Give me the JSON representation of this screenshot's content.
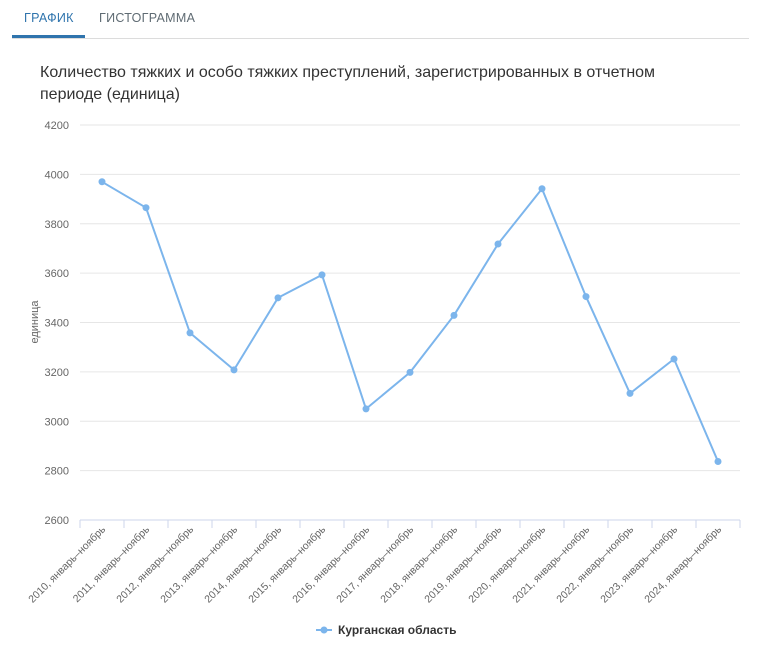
{
  "tabs": [
    {
      "label": "ГРАФИК",
      "active": true
    },
    {
      "label": "ГИСТОГРАММА",
      "active": false
    }
  ],
  "colors": {
    "accent": "#2f74ad",
    "series": "#7cb5ec",
    "grid": "#e6e6e6",
    "text": "#333333"
  },
  "chart_data": {
    "type": "line",
    "title": "Количество тяжких и особо тяжких преступлений, зарегистрированных в отчетном периоде (единица)",
    "xlabel": "",
    "ylabel": "единица",
    "ylim": [
      2600,
      4200
    ],
    "yticks": [
      2600,
      2800,
      3000,
      3200,
      3400,
      3600,
      3800,
      4000,
      4200
    ],
    "grid": true,
    "legend_position": "bottom-center",
    "categories": [
      "2010, январь–ноябрь",
      "2011, январь–ноябрь",
      "2012, январь–ноябрь",
      "2013, январь–ноябрь",
      "2014, январь–ноябрь",
      "2015, январь–ноябрь",
      "2016, январь–ноябрь",
      "2017, январь–ноябрь",
      "2018, январь–ноябрь",
      "2019, январь–ноябрь",
      "2020, январь–ноябрь",
      "2021, январь–ноябрь",
      "2022, январь–ноябрь",
      "2023, январь–ноябрь",
      "2024, январь–ноябрь"
    ],
    "series": [
      {
        "name": "Курганская область",
        "color": "#7cb5ec",
        "values": [
          3970,
          3865,
          3358,
          3208,
          3500,
          3593,
          3050,
          3198,
          3429,
          3718,
          3942,
          3505,
          3113,
          3252,
          2837
        ]
      }
    ]
  }
}
